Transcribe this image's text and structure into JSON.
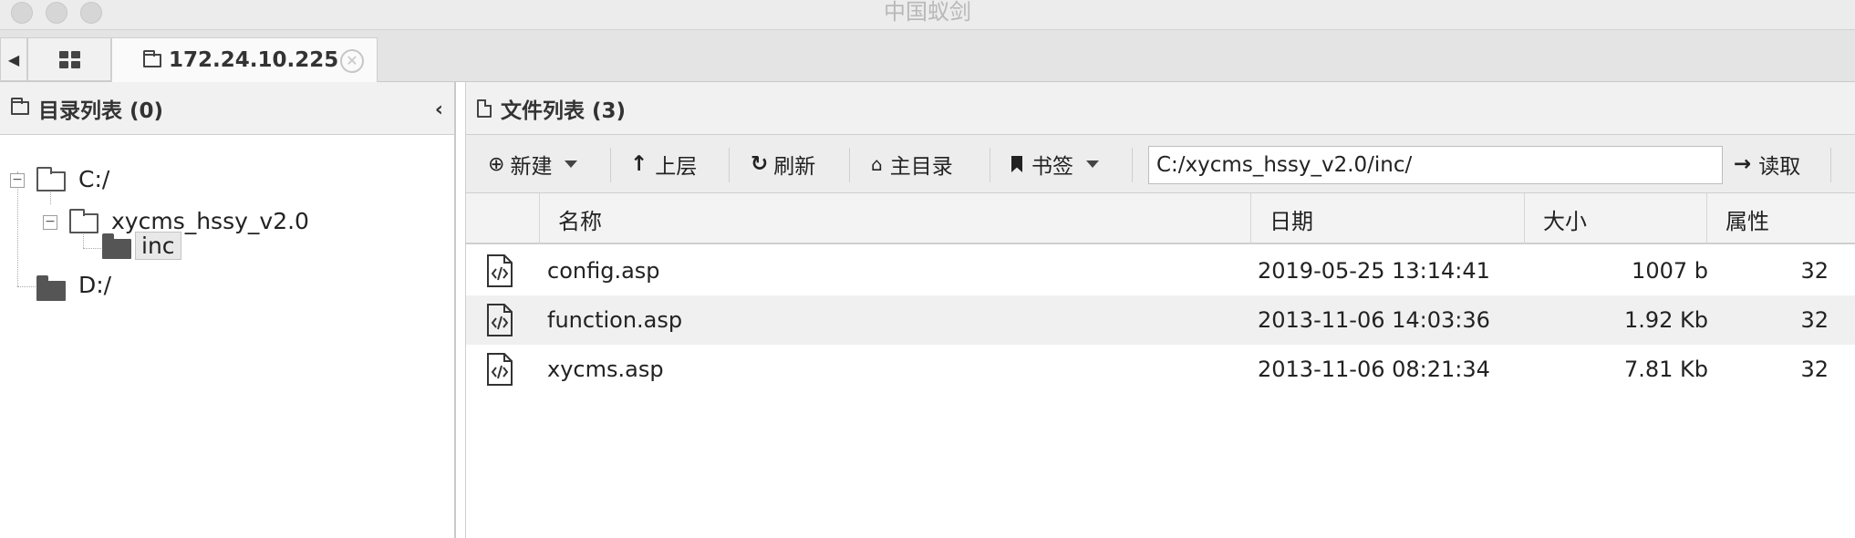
{
  "window": {
    "title": "中国蚁剑"
  },
  "tabs": {
    "active_label": "172.24.10.225",
    "close_glyph": "✕"
  },
  "left_panel": {
    "title": "目录列表 (0)",
    "collapse_glyph": "‹",
    "tree": [
      {
        "label": "C:/",
        "expanded": true
      },
      {
        "label": "xycms_hssy_v2.0",
        "expanded": true
      },
      {
        "label": "inc",
        "selected": true
      },
      {
        "label": "D:/"
      }
    ]
  },
  "right_panel": {
    "title": "文件列表 (3)",
    "toolbar": {
      "new_label": "新建",
      "up_label": "上层",
      "refresh_label": "刷新",
      "home_label": "主目录",
      "bookmark_label": "书签",
      "path_value": "C:/xycms_hssy_v2.0/inc/",
      "read_label": "读取"
    },
    "columns": {
      "name": "名称",
      "date": "日期",
      "size": "大小",
      "attr": "属性"
    },
    "rows": [
      {
        "name": "config.asp",
        "date": "2019-05-25 13:14:41",
        "size": "1007 b",
        "attr": "32"
      },
      {
        "name": "function.asp",
        "date": "2013-11-06 14:03:36",
        "size": "1.92 Kb",
        "attr": "32"
      },
      {
        "name": "xycms.asp",
        "date": "2013-11-06 08:21:34",
        "size": "7.81 Kb",
        "attr": "32"
      }
    ]
  }
}
